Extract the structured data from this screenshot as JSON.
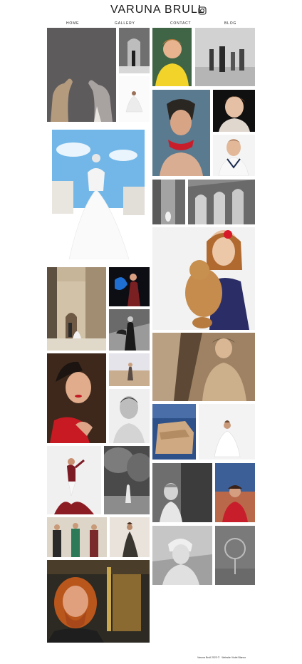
{
  "header": {
    "title": "VARUNA BRULL",
    "instagram_icon": "instagram-icon"
  },
  "nav": {
    "items": [
      {
        "label": "HOME"
      },
      {
        "label": "GALLERY"
      },
      {
        "label": "CONTACT"
      },
      {
        "label": "BLOG"
      }
    ]
  },
  "gallery": {
    "photos": [
      {
        "subject": "two greyhound dogs"
      },
      {
        "subject": "street portrait black and white"
      },
      {
        "subject": "woman in white dress sitting"
      },
      {
        "subject": "boy in yellow shirt"
      },
      {
        "subject": "family on beach black and white"
      },
      {
        "subject": "woman with headpiece and red necklace"
      },
      {
        "subject": "girl portrait"
      },
      {
        "subject": "boy in sailor outfit"
      },
      {
        "subject": "bride on rooftop under blue sky"
      },
      {
        "subject": "small figure in ruins"
      },
      {
        "subject": "roman arches"
      },
      {
        "subject": "girl hugging teddy bear"
      },
      {
        "subject": "couple in street"
      },
      {
        "subject": "flamenco dancer with blue fan"
      },
      {
        "subject": "dancer black and white"
      },
      {
        "subject": "man in sepia"
      },
      {
        "subject": "child on beach"
      },
      {
        "subject": "woman with red lips"
      },
      {
        "subject": "man portrait black and white"
      },
      {
        "subject": "stone blocks by sea"
      },
      {
        "subject": "girl in white dress"
      },
      {
        "subject": "flamenco dancer in red"
      },
      {
        "subject": "woman in forest"
      },
      {
        "subject": "girl black and white"
      },
      {
        "subject": "woman at sunset"
      },
      {
        "subject": "toreros"
      },
      {
        "subject": "woman in dress"
      },
      {
        "subject": "woman with turban black and white"
      },
      {
        "subject": "fan object"
      },
      {
        "subject": "man with red hair and beard"
      }
    ]
  },
  "footer": {
    "credit": "Varuna Brull 2023 ©",
    "designer": "Website Violet Blanco"
  },
  "colors": {
    "background": "#ffffff",
    "text": "#222222"
  }
}
